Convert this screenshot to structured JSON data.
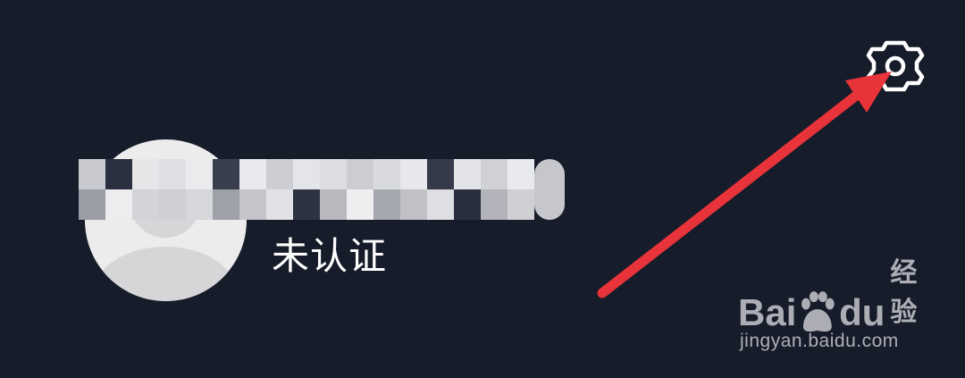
{
  "profile": {
    "verify_status": "未认证"
  },
  "header": {
    "settings_icon": "gear-icon"
  },
  "watermark": {
    "brand_bai": "Bai",
    "brand_du": "du",
    "brand_suffix": "经验",
    "url": "jingyan.baidu.com"
  },
  "colors": {
    "background": "#171c2a",
    "annotation_arrow": "#e8333a",
    "text": "#ffffff"
  }
}
